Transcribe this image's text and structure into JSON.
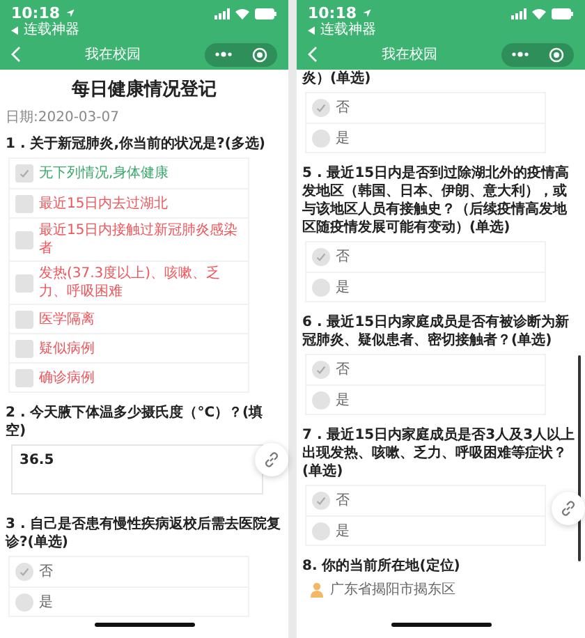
{
  "screens": [
    {
      "status_bar": {
        "time": "10:18",
        "back_app": "连载神器"
      },
      "nav_title": "我在校园",
      "scrollbar": false,
      "items": [
        {
          "kind": "title",
          "text": "每日健康情况登记"
        },
        {
          "kind": "date",
          "text": "日期:2020-03-07"
        },
        {
          "kind": "multi_choice",
          "text": "1 . 关于新冠肺炎,你当前的状况是?(多选)",
          "options": [
            {
              "label": "无下列情况,身体健康",
              "checked": true,
              "color": "#3aa86b"
            },
            {
              "label": "最近15日内去过湖北",
              "checked": false,
              "color": "#f0555a"
            },
            {
              "label": "最近15日内接触过新冠肺炎感染者",
              "checked": false,
              "color": "#f0555a"
            },
            {
              "label": "发热(37.3度以上)、咳嗽、乏力、呼吸困难",
              "checked": false,
              "color": "#f0555a"
            },
            {
              "label": "医学隔离",
              "checked": false,
              "color": "#f0555a"
            },
            {
              "label": "疑似病例",
              "checked": false,
              "color": "#f0555a"
            },
            {
              "label": "确诊病例",
              "checked": false,
              "color": "#f0555a"
            }
          ]
        },
        {
          "kind": "fill",
          "text": "2 . 今天腋下体温多少摄氏度（°C）？(填空)",
          "answer": "36.5"
        },
        {
          "kind": "single_choice",
          "text": "3 . 自己是否患有慢性疾病返校后需去医院复诊?(单选)",
          "options": [
            {
              "label": "否",
              "checked": true
            },
            {
              "label": "是",
              "checked": false
            }
          ]
        }
      ]
    },
    {
      "status_bar": {
        "time": "10:18",
        "back_app": "连载神器"
      },
      "nav_title": "我在校园",
      "scrollbar": true,
      "items": [
        {
          "kind": "single_choice",
          "text": "炎）(单选)",
          "options": [
            {
              "label": "否",
              "checked": true
            },
            {
              "label": "是",
              "checked": false
            }
          ]
        },
        {
          "kind": "single_choice",
          "text": "5 . 最近15日内是否到过除湖北外的疫情高发地区（韩国、日本、伊朗、意大利），或与该地区人员有接触史？（后续疫情高发地区随疫情发展可能有变动）(单选)",
          "options": [
            {
              "label": "否",
              "checked": true
            },
            {
              "label": "是",
              "checked": false
            }
          ]
        },
        {
          "kind": "single_choice",
          "text": "6 . 最近15日内家庭成员是否有被诊断为新冠肺炎、疑似患者、密切接触者？(单选)",
          "options": [
            {
              "label": "否",
              "checked": true
            },
            {
              "label": "是",
              "checked": false
            }
          ]
        },
        {
          "kind": "single_choice",
          "text": "7 . 最近15日内家庭成员是否3人及3人以上出现发热、咳嗽、乏力、呼吸困难等症状？(单选)",
          "options": [
            {
              "label": "否",
              "checked": true
            },
            {
              "label": "是",
              "checked": false
            }
          ]
        },
        {
          "kind": "location",
          "text": "8. 你的当前所在地(定位)",
          "value": "广东省揭阳市揭东区"
        }
      ]
    }
  ]
}
